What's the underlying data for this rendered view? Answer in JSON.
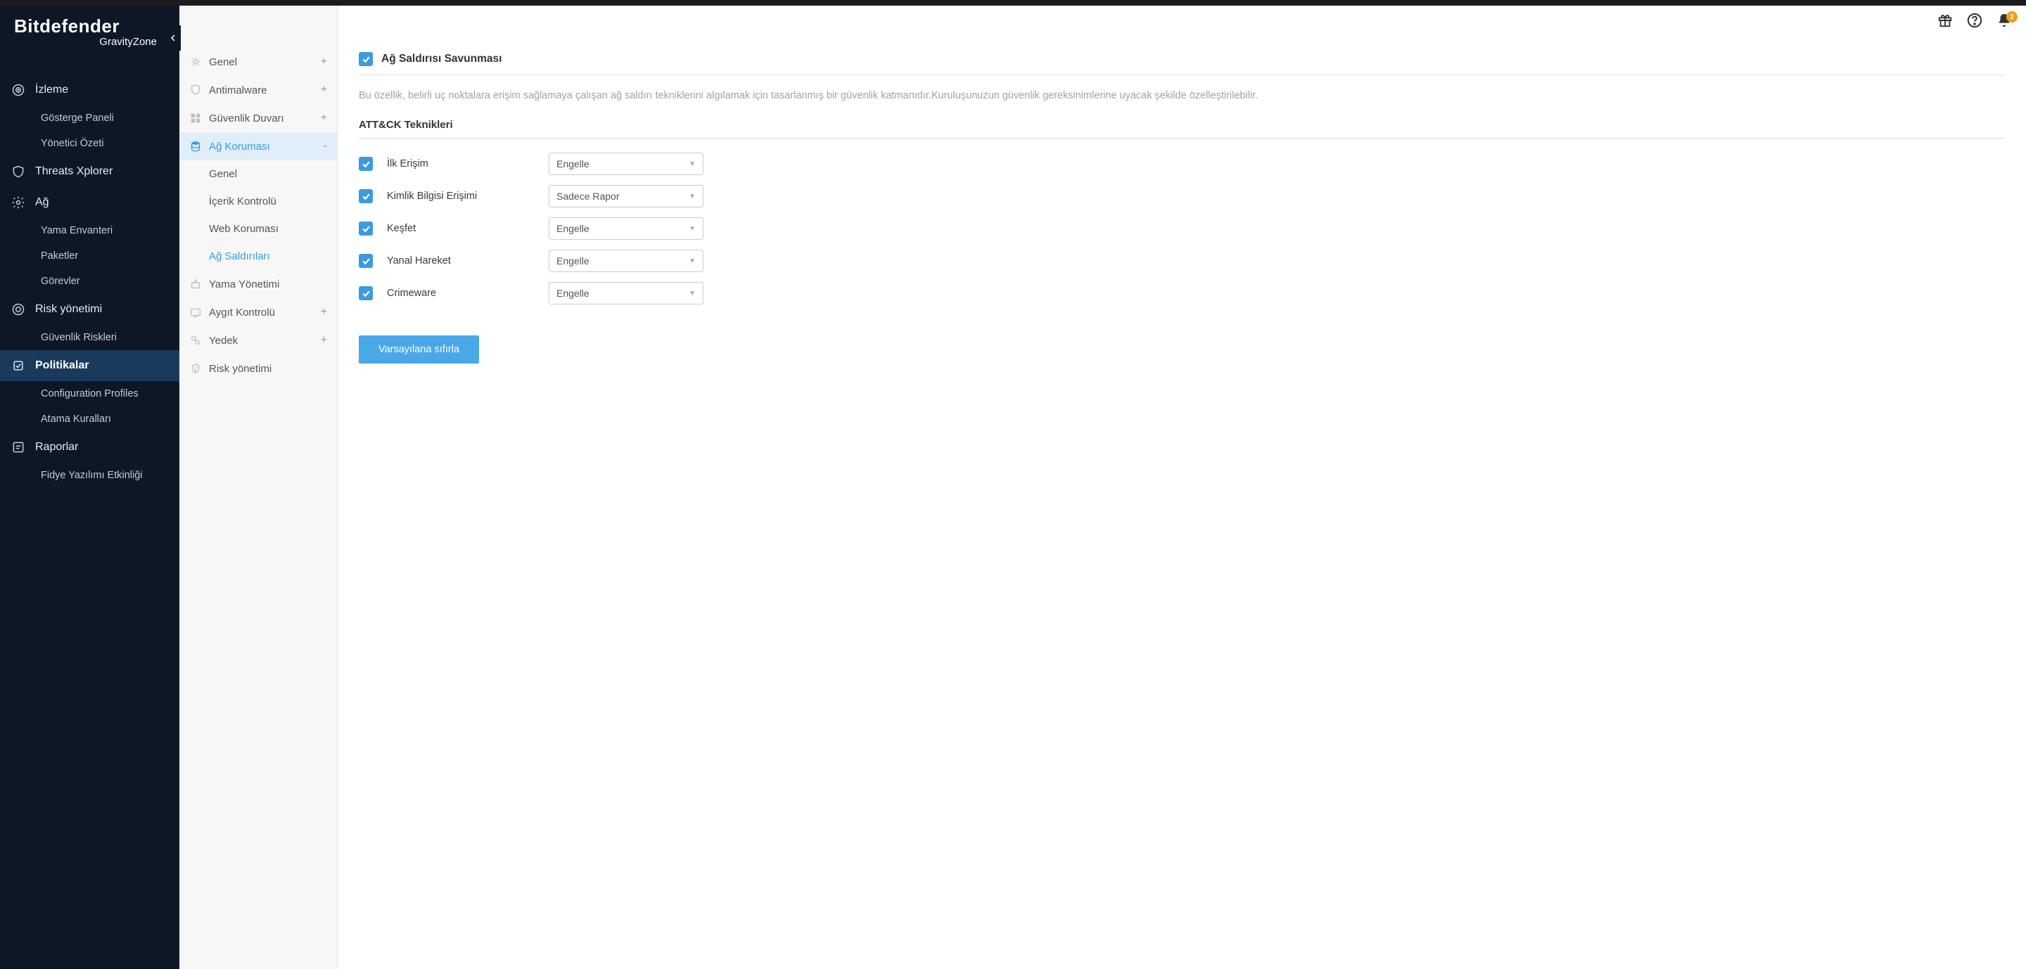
{
  "brand": {
    "name": "Bitdefender",
    "sub": "GravityZone"
  },
  "header": {
    "notif_count": "2"
  },
  "sidebar": {
    "items": [
      {
        "label": "İzleme",
        "subs": [
          "Gösterge Paneli",
          "Yönetici Özeti"
        ]
      },
      {
        "label": "Threats Xplorer",
        "subs": []
      },
      {
        "label": "Ağ",
        "subs": [
          "Yama Envanteri",
          "Paketler",
          "Görevler"
        ]
      },
      {
        "label": "Risk yönetimi",
        "subs": [
          "Güvenlik Riskleri"
        ]
      },
      {
        "label": "Politikalar",
        "subs": [
          "Configuration Profiles",
          "Atama Kuralları"
        ],
        "active": true
      },
      {
        "label": "Raporlar",
        "subs": [
          "Fidye Yazılımı Etkinliği"
        ]
      }
    ]
  },
  "midnav": {
    "items": [
      {
        "label": "Genel",
        "expandable": true
      },
      {
        "label": "Antimalware",
        "expandable": true
      },
      {
        "label": "Güvenlik Duvarı",
        "expandable": true
      },
      {
        "label": "Ağ Koruması",
        "expandable": true,
        "active": true,
        "expanded": true,
        "subs": [
          {
            "label": "Genel"
          },
          {
            "label": "İçerik Kontrolü"
          },
          {
            "label": "Web Koruması"
          },
          {
            "label": "Ağ Saldırıları",
            "active": true
          }
        ]
      },
      {
        "label": "Yama Yönetimi"
      },
      {
        "label": "Aygıt Kontrolü",
        "expandable": true
      },
      {
        "label": "Yedek",
        "expandable": true
      },
      {
        "label": "Risk yönetimi"
      }
    ]
  },
  "main": {
    "section_title": "Ağ Saldırısı Savunması",
    "description": "Bu özellik, belirli uç noktalara erişim sağlamaya çalışan ağ saldırı tekniklerini algılamak için tasarlanmış bir güvenlik katmanıdır.Kuruluşunuzun güvenlik gereksinimlerine uyacak şekilde özelleştirilebilir.",
    "subhead": "ATT&CK Teknikleri",
    "techniques": [
      {
        "label": "İlk Erişim",
        "action": "Engelle",
        "checked": true
      },
      {
        "label": "Kimlik Bilgisi Erişimi",
        "action": "Sadece Rapor",
        "checked": true
      },
      {
        "label": "Keşfet",
        "action": "Engelle",
        "checked": true
      },
      {
        "label": "Yanal Hareket",
        "action": "Engelle",
        "checked": true
      },
      {
        "label": "Crimeware",
        "action": "Engelle",
        "checked": true
      }
    ],
    "reset_label": "Varsayılana sıfırla"
  }
}
